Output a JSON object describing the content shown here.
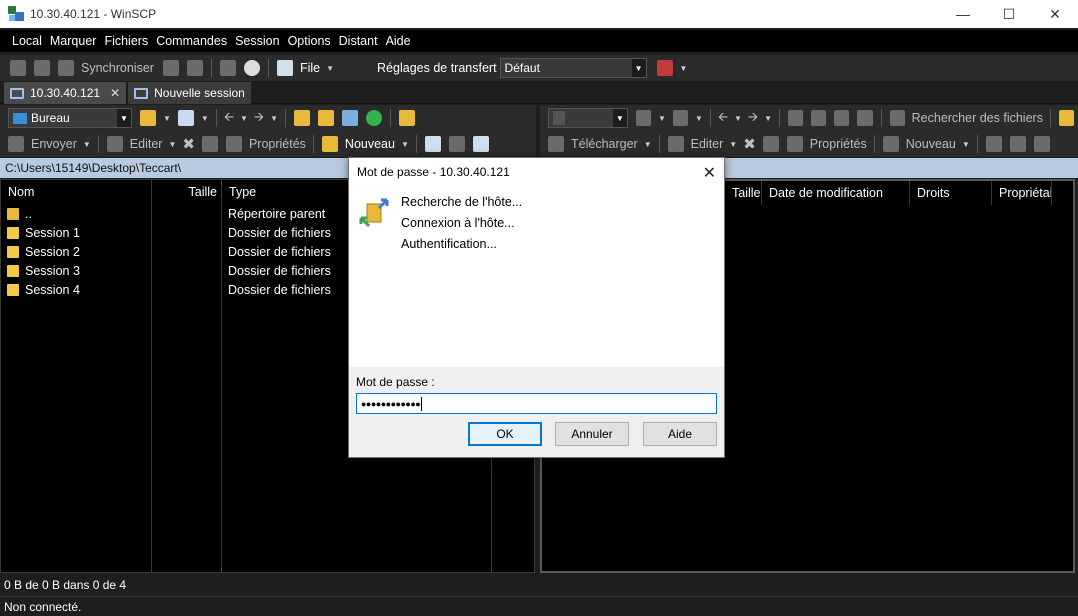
{
  "window": {
    "title": "10.30.40.121 - WinSCP"
  },
  "menu": [
    "Local",
    "Marquer",
    "Fichiers",
    "Commandes",
    "Session",
    "Options",
    "Distant",
    "Aide"
  ],
  "toolbar_top": {
    "synchroniser": "Synchroniser",
    "file": "File",
    "reglages_label": "Réglages de transfert",
    "reglages_value": "Défaut"
  },
  "tabs": [
    {
      "label": "10.30.40.121",
      "closable": true
    },
    {
      "label": "Nouvelle session"
    }
  ],
  "left": {
    "location": "Bureau",
    "actions": {
      "envoyer": "Envoyer",
      "editer": "Editer",
      "proprietes": "Propriétés",
      "nouveau": "Nouveau"
    },
    "path": "C:\\Users\\15149\\Desktop\\Teccart\\",
    "columns": {
      "nom": "Nom",
      "taille": "Taille",
      "type": "Type"
    },
    "rows": [
      {
        "name": "..",
        "type": "Répertoire parent"
      },
      {
        "name": "Session 1",
        "type": "Dossier de fichiers"
      },
      {
        "name": "Session 2",
        "type": "Dossier de fichiers"
      },
      {
        "name": "Session 3",
        "type": "Dossier de fichiers"
      },
      {
        "name": "Session 4",
        "type": "Dossier de fichiers"
      }
    ],
    "status": "0 B de 0 B dans 0 de 4"
  },
  "right": {
    "search": "Rechercher des fichiers",
    "actions": {
      "telecharger": "Télécharger",
      "editer": "Editer",
      "proprietes": "Propriétés",
      "nouveau": "Nouveau"
    },
    "columns": {
      "taille": "Taille",
      "date": "Date de modification",
      "droits": "Droits",
      "proprietaire": "Propriétaire"
    }
  },
  "statusbar": "Non connecté.",
  "dialog": {
    "title": "Mot de passe - 10.30.40.121",
    "steps": [
      "Recherche de l'hôte...",
      "Connexion à l'hôte...",
      "Authentification..."
    ],
    "password_label": "Mot de passe :",
    "password_mask": "●●●●●●●●●●●●",
    "ok": "OK",
    "cancel": "Annuler",
    "help": "Aide"
  },
  "colors": {
    "path_bar": "#b9cbe0",
    "folder": "#f3c948",
    "accent": "#0078d7"
  }
}
